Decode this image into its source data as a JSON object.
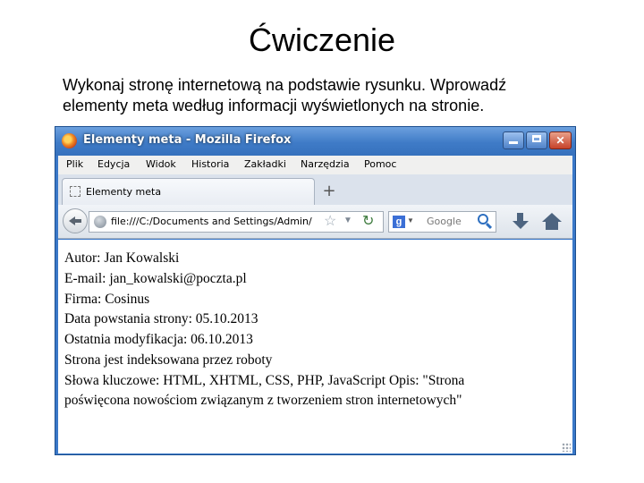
{
  "slide": {
    "title": "Ćwiczenie",
    "description_lines": [
      "Wykonaj stronę internetową na podstawie rysunku. Wprowadź",
      "elementy meta według informacji wyświetlonych na stronie."
    ]
  },
  "browser": {
    "window_title": "Elementy meta - Mozilla Firefox",
    "window_buttons": {
      "minimize": "minimize",
      "maximize": "maximize",
      "close": "✕"
    },
    "menu": [
      "Plik",
      "Edycja",
      "Widok",
      "Historia",
      "Zakładki",
      "Narzędzia",
      "Pomoc"
    ],
    "tab_label": "Elementy meta",
    "new_tab_symbol": "+",
    "url": "file:///C:/Documents and Settings/Admin/Pulpit/meta.html",
    "search_placeholder": "Google",
    "search_engine_letter": "g",
    "icons": [
      "firefox-logo-icon",
      "back-arrow-icon",
      "globe-icon",
      "star-icon",
      "dropdown-icon",
      "reload-icon",
      "google-icon",
      "magnifier-icon",
      "download-icon",
      "home-icon",
      "page-icon",
      "resize-grip-icon"
    ]
  },
  "page_content": {
    "lines": [
      "Autor: Jan Kowalski",
      "E-mail: jan_kowalski@poczta.pl",
      "Firma: Cosinus",
      "Data powstania strony: 05.10.2013",
      "Ostatnia modyfikacja: 06.10.2013",
      "Strona jest indeksowana przez roboty",
      "Słowa kluczowe: HTML, XHTML, CSS, PHP, JavaScript Opis: \"Strona",
      "poświęcona nowościom związanym z tworzeniem stron internetowych\""
    ]
  }
}
